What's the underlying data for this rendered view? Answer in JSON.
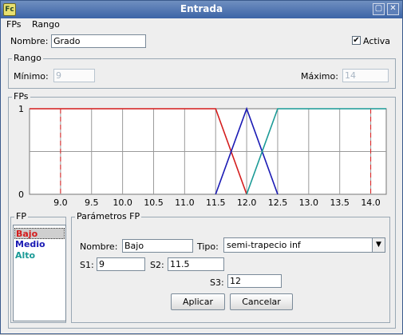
{
  "window": {
    "title": "Entrada",
    "icon": "fuzzy-app-icon",
    "minimize_glyph": "▢",
    "close_glyph": "✕"
  },
  "menu": {
    "items": [
      "FPs",
      "Rango"
    ]
  },
  "nombre": {
    "label": "Nombre:",
    "value": "Grado"
  },
  "activa": {
    "label": "Activa",
    "checked": true,
    "check_glyph": "✔"
  },
  "rango": {
    "title": "Rango",
    "minimo_label": "Mínimo:",
    "minimo_value": "9",
    "maximo_label": "Máximo:",
    "maximo_value": "14"
  },
  "fps_group": {
    "title": "FPs"
  },
  "chart_data": {
    "type": "line",
    "x_ticks": [
      "9.0",
      "9.5",
      "10.0",
      "10.5",
      "11.0",
      "11.5",
      "12.0",
      "12.5",
      "13.0",
      "13.5",
      "14.0"
    ],
    "x_tick_values": [
      9.0,
      9.5,
      10.0,
      10.5,
      11.0,
      11.5,
      12.0,
      12.5,
      13.0,
      13.5,
      14.0
    ],
    "xlim": [
      8.5,
      14.25
    ],
    "y_ticks": [
      "0",
      "1"
    ],
    "ylim": [
      0,
      1
    ],
    "grid": true,
    "range_markers": [
      9,
      14
    ],
    "series": [
      {
        "name": "Bajo",
        "color": "#d41c1c",
        "x": [
          8.5,
          11.5,
          12.0
        ],
        "y": [
          1,
          1,
          0
        ]
      },
      {
        "name": "Medio",
        "color": "#1a1ab4",
        "x": [
          11.5,
          12.0,
          12.5
        ],
        "y": [
          0,
          1,
          0
        ]
      },
      {
        "name": "Alto",
        "color": "#1a9a96",
        "x": [
          12.0,
          12.5,
          14.25
        ],
        "y": [
          0,
          1,
          1
        ]
      }
    ]
  },
  "fp_list": {
    "title": "FP",
    "items": [
      {
        "label": "Bajo",
        "color": "#d41c1c",
        "selected": true
      },
      {
        "label": "Medio",
        "color": "#1a1ab4",
        "selected": false
      },
      {
        "label": "Alto",
        "color": "#1a9a96",
        "selected": false
      }
    ]
  },
  "parametros": {
    "title": "Parámetros FP",
    "nombre_label": "Nombre:",
    "nombre_value": "Bajo",
    "tipo_label": "Tipo:",
    "tipo_value": "semi-trapecio inf",
    "tipo_arrow": "▼",
    "s1_label": "S1:",
    "s1_value": "9",
    "s2_label": "S2:",
    "s2_value": "11.5",
    "s3_label": "S3:",
    "s3_value": "12"
  },
  "buttons": {
    "aplicar": "Aplicar",
    "cancelar": "Cancelar"
  }
}
